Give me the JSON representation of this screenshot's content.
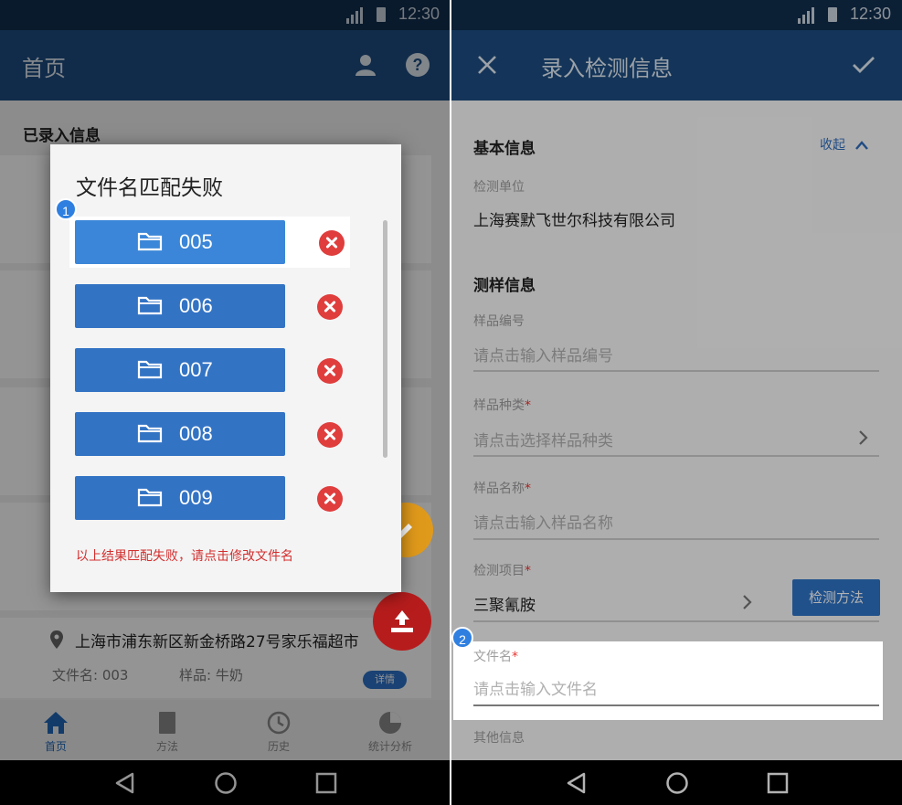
{
  "status": {
    "time": "12:30"
  },
  "left": {
    "title": "首页",
    "section_label": "已录入信息",
    "dialog": {
      "title": "文件名匹配失败",
      "files": [
        "005",
        "006",
        "007",
        "008",
        "009"
      ],
      "error_message": "以上结果匹配失败，请点击修改文件名"
    },
    "badge": "1",
    "card": {
      "address": "上海市浦东新区新金桥路27号家乐福超市",
      "file_label": "文件名: 003",
      "sample_label": "样品: 牛奶",
      "detail_button": "详情"
    },
    "nav": [
      {
        "label": "首页",
        "icon": "home-icon"
      },
      {
        "label": "方法",
        "icon": "book-icon"
      },
      {
        "label": "历史",
        "icon": "history-icon"
      },
      {
        "label": "统计分析",
        "icon": "chart-icon"
      }
    ]
  },
  "right": {
    "title": "录入检测信息",
    "basic_info": "基本信息",
    "collapse": "收起",
    "org_label": "检测单位",
    "org_value": "上海赛默飞世尔科技有限公司",
    "sampling_info": "测样信息",
    "sample_no_label": "样品编号",
    "sample_no_placeholder": "请点击输入样品编号",
    "sample_type_label": "样品种类",
    "sample_type_placeholder": "请点击选择样品种类",
    "sample_name_label": "样品名称",
    "sample_name_placeholder": "请点击输入样品名称",
    "test_item_label": "检测项目",
    "test_item_value": "三聚氰胺",
    "method_button": "检测方法",
    "filename_label": "文件名",
    "filename_placeholder": "请点击输入文件名",
    "other_info": "其他信息",
    "badge": "2"
  },
  "colors": {
    "appbar": "#1e4c80",
    "statusbar": "#112d4d",
    "primary_button": "#3373c4",
    "delete": "#e03d3d",
    "error_text": "#d32f2f"
  }
}
